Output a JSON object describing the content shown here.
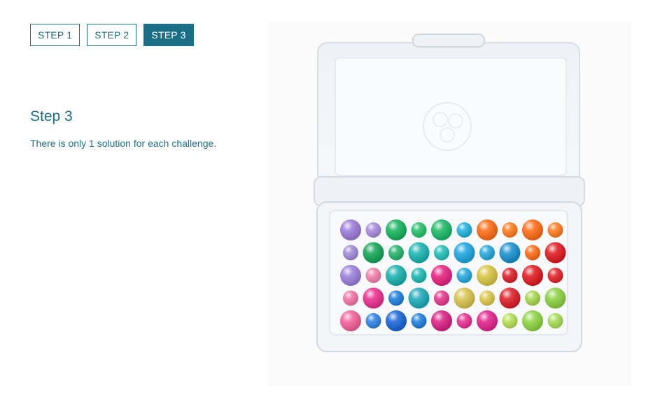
{
  "tabs": [
    {
      "label": "STEP 1",
      "active": false
    },
    {
      "label": "STEP 2",
      "active": false
    },
    {
      "label": "STEP 3",
      "active": true
    }
  ],
  "content": {
    "title": "Step 3",
    "description": "There is only 1 solution for each challenge."
  },
  "colors": {
    "accent": "#1a6e86",
    "text": "#1d6f86",
    "background": "#ffffff"
  },
  "image": {
    "subject": "puzzle-case-with-colored-beads"
  }
}
